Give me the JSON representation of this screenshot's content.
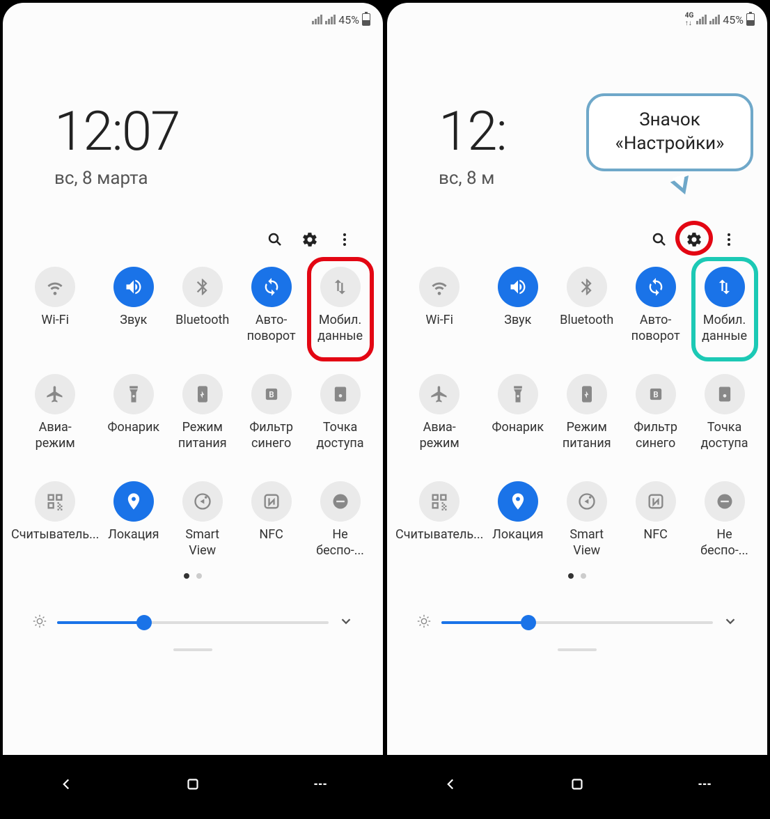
{
  "phones": [
    {
      "status": {
        "show4g": false,
        "percent": "45%"
      },
      "clock": "12:07",
      "date": "вс, 8 марта",
      "tiles": [
        {
          "icon": "wifi",
          "on": false,
          "label": "Wi-Fi"
        },
        {
          "icon": "sound",
          "on": true,
          "label": "Звук"
        },
        {
          "icon": "bluetooth",
          "on": false,
          "label": "Bluetooth"
        },
        {
          "icon": "rotate",
          "on": true,
          "label": "Авто-\nповорот"
        },
        {
          "icon": "data",
          "on": false,
          "label": "Мобил.\nданные",
          "ring": "red"
        },
        {
          "icon": "airplane",
          "on": false,
          "label": "Авиа-\nрежим"
        },
        {
          "icon": "torch",
          "on": false,
          "label": "Фонарик"
        },
        {
          "icon": "power",
          "on": false,
          "label": "Режим\nпитания"
        },
        {
          "icon": "bluelight",
          "on": false,
          "label": "Фильтр\nсинего"
        },
        {
          "icon": "hotspot",
          "on": false,
          "label": "Точка\nдоступа"
        },
        {
          "icon": "qr",
          "on": false,
          "label": "Считыватель..."
        },
        {
          "icon": "location",
          "on": true,
          "label": "Локация"
        },
        {
          "icon": "smartview",
          "on": false,
          "label": "Smart\nView"
        },
        {
          "icon": "nfc",
          "on": false,
          "label": "NFC"
        },
        {
          "icon": "dnd",
          "on": false,
          "label": "Не\nбеспо-..."
        }
      ],
      "brightness": 32,
      "annotations": {
        "settingsRing": false,
        "bubble": null
      }
    },
    {
      "status": {
        "show4g": true,
        "percent": "45%"
      },
      "clock": "12:",
      "date": "вс, 8 м",
      "tiles": [
        {
          "icon": "wifi",
          "on": false,
          "label": "Wi-Fi"
        },
        {
          "icon": "sound",
          "on": true,
          "label": "Звук"
        },
        {
          "icon": "bluetooth",
          "on": false,
          "label": "Bluetooth"
        },
        {
          "icon": "rotate",
          "on": true,
          "label": "Авто-\nповорот"
        },
        {
          "icon": "data",
          "on": true,
          "label": "Мобил.\nданные",
          "ring": "teal"
        },
        {
          "icon": "airplane",
          "on": false,
          "label": "Авиа-\nрежим"
        },
        {
          "icon": "torch",
          "on": false,
          "label": "Фонарик"
        },
        {
          "icon": "power",
          "on": false,
          "label": "Режим\nпитания"
        },
        {
          "icon": "bluelight",
          "on": false,
          "label": "Фильтр\nсинего"
        },
        {
          "icon": "hotspot",
          "on": false,
          "label": "Точка\nдоступа"
        },
        {
          "icon": "qr",
          "on": false,
          "label": "Считыватель..."
        },
        {
          "icon": "location",
          "on": true,
          "label": "Локация"
        },
        {
          "icon": "smartview",
          "on": false,
          "label": "Smart\nView"
        },
        {
          "icon": "nfc",
          "on": false,
          "label": "NFC"
        },
        {
          "icon": "dnd",
          "on": false,
          "label": "Не\nбеспо-..."
        }
      ],
      "brightness": 32,
      "annotations": {
        "settingsRing": true,
        "bubble": "Значок\n«Настройки»"
      }
    }
  ]
}
